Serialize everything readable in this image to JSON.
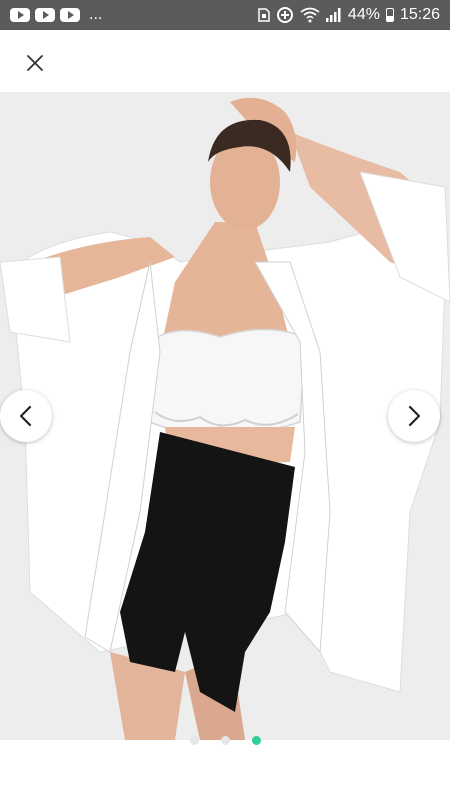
{
  "status_bar": {
    "overflow": "...",
    "battery_percent": "44%",
    "time": "15:26",
    "icons": [
      "youtube-icon",
      "youtube-icon",
      "youtube-icon",
      "sim-icon",
      "data-saver-icon",
      "wifi-icon",
      "signal-icon",
      "battery-icon"
    ]
  },
  "app_bar": {
    "close_icon": "close-icon"
  },
  "gallery": {
    "image_subject": "model-photo",
    "prev_icon": "chevron-left-icon",
    "next_icon": "chevron-right-icon",
    "page_count": 3,
    "active_page": 3
  },
  "colors": {
    "status_bar": "#5b5b5b",
    "accent": "#2fcf95",
    "image_background": "#ededed",
    "skirt": "#141414",
    "shirt": "#ffffff"
  }
}
